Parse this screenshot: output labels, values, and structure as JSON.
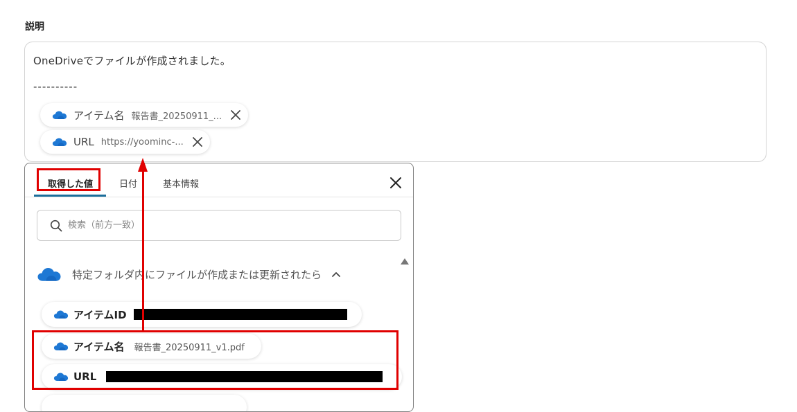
{
  "field": {
    "label": "説明",
    "line1": "OneDriveでファイルが作成されました。",
    "line2": "----------"
  },
  "chips": [
    {
      "label": "アイテム名",
      "value": "報告書_20250911_...",
      "icon": "onedrive-cloud-icon"
    },
    {
      "label": "URL",
      "value": "https://yoominc-...",
      "icon": "onedrive-cloud-icon"
    }
  ],
  "panel": {
    "tabs": [
      {
        "label": "取得した値",
        "active": true
      },
      {
        "label": "日付",
        "active": false
      },
      {
        "label": "基本情報",
        "active": false
      }
    ],
    "search_placeholder": "検索（前方一致）",
    "section_title": "特定フォルダ内にファイルが作成または更新されたら",
    "items": [
      {
        "label": "アイテムID",
        "value": "",
        "redacted": true
      },
      {
        "label": "アイテム名",
        "value": "報告書_20250911_v1.pdf",
        "redacted": false
      },
      {
        "label": "URL",
        "value": "",
        "redacted": true
      }
    ]
  },
  "colors": {
    "onedrive_blue": "#1e78d4",
    "highlight_red": "#e00000",
    "tab_underline": "#1b6e9b"
  }
}
